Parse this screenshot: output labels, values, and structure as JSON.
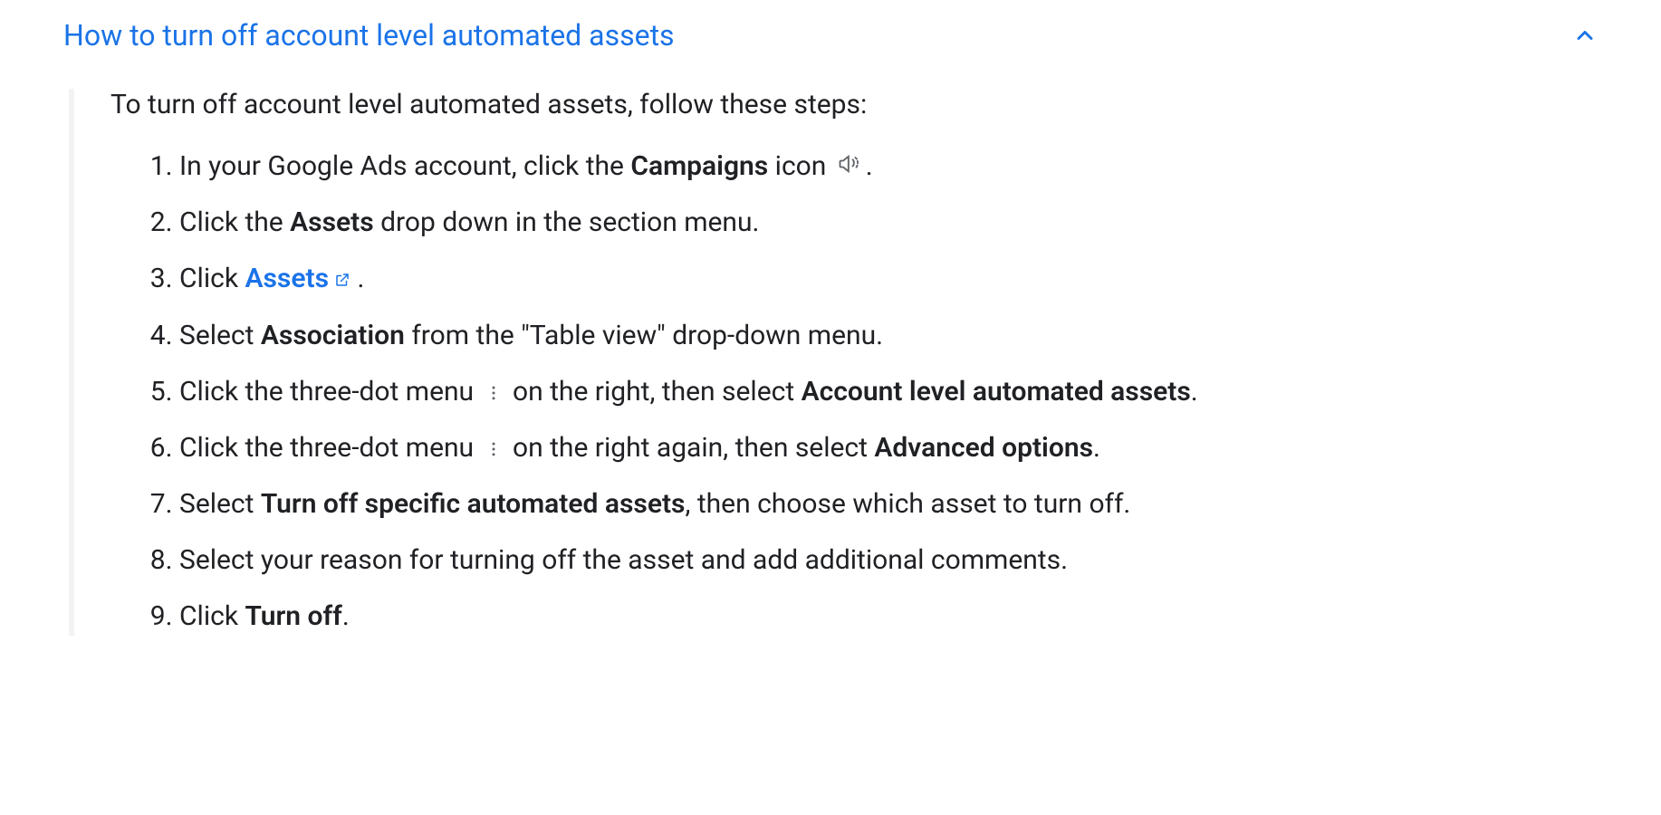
{
  "header": {
    "title": "How to turn off account level automated assets"
  },
  "content": {
    "intro": "To turn off account level automated assets, follow these steps:",
    "steps": {
      "s1": {
        "pre": "In your Google Ads account, click the ",
        "bold": "Campaigns",
        "post": " icon ",
        "tail": "."
      },
      "s2": {
        "pre": "Click the ",
        "bold": "Assets",
        "post": " drop down in the section menu."
      },
      "s3": {
        "pre": "Click ",
        "link": "Assets",
        "post": " ."
      },
      "s4": {
        "pre": "Select ",
        "bold": "Association",
        "post": " from the \"Table view\" drop-down menu."
      },
      "s5": {
        "pre": "Click the three-dot menu ",
        "mid": " on the right, then select ",
        "bold": "Account level automated assets",
        "tail": "."
      },
      "s6": {
        "pre": "Click the three-dot menu ",
        "mid": " on the right again, then select ",
        "bold": "Advanced options",
        "tail": "."
      },
      "s7": {
        "pre": "Select ",
        "bold": "Turn off specific automated assets",
        "post": ", then choose which asset to turn off."
      },
      "s8": {
        "text": "Select your reason for turning off the asset and add additional comments."
      },
      "s9": {
        "pre": "Click ",
        "bold": "Turn off",
        "tail": "."
      }
    }
  }
}
